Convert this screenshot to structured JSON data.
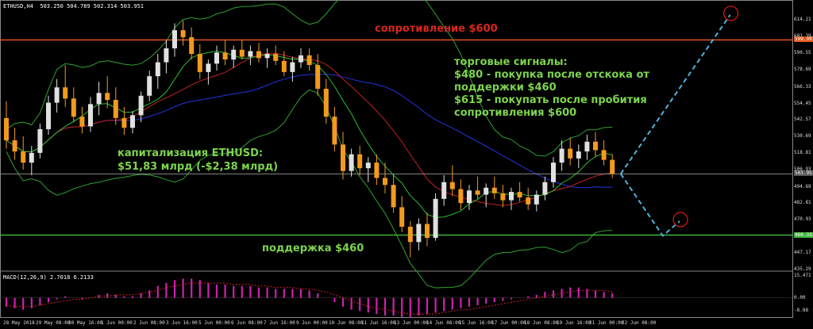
{
  "header": {
    "symbol": "ETHUSD,H4",
    "ohlc": "503.250 504.789 502.314 503.951"
  },
  "macd_header": "MACD(12,26,9) 2.7018 6.2133",
  "annotations": {
    "resistance": "сопротивление $600",
    "support": "поддержка $460",
    "capitalization_title": "капитализация ETHUSD:",
    "capitalization_value": "$51,83 млрд (-$2,38 млрд)",
    "signals_title": "торговые сигналы:",
    "signal_1a": "$480 - покупка после отскока от",
    "signal_1b": "поддержки $460",
    "signal_2a": "$615 - покупать после пробития",
    "signal_2b": "сопротивления $600"
  },
  "colors": {
    "background": "#000000",
    "bull": "#e0e0e0",
    "bear": "#f39a1e",
    "resistance": "#e0561c",
    "support": "#3cb43c",
    "bollinger": "#2fa12f",
    "ma_blue": "#2233dd",
    "ma_red": "#c02020",
    "ma_green": "#2bbd2b",
    "forecast": "#4fb2dd",
    "target_circle": "#e01818",
    "macd_hist": "#d020b0",
    "macd_signal": "#d02020"
  },
  "chart_data": {
    "type": "candlestick",
    "instrument": "ETHUSD",
    "timeframe": "H4",
    "y_axis": {
      "ylim": [
        435.29,
        623
      ],
      "ticks": [
        614.21,
        602.39,
        590.55,
        578.69,
        566.33,
        554.45,
        542.57,
        530.69,
        518.81,
        506.93,
        494.69,
        482.81,
        470.93,
        459.05,
        447.17,
        435.29
      ]
    },
    "levels": {
      "resistance": 600,
      "resistance_label": "599.997",
      "support": 460,
      "support_label": "460.333",
      "current_price": 503.951,
      "current_label": "503.951"
    },
    "x_tick_labels": [
      "28 May 2018",
      "29 May 08:00",
      "30 May 16:00",
      "1 Jun 00:00",
      "2 Jun 08:00",
      "3 Jun 16:00",
      "5 Jun 00:00",
      "6 Jun 08:00",
      "7 Jun 16:00",
      "9 Jun 00:00",
      "10 Jun 08:00",
      "11 Jun 16:00",
      "13 Jun 00:00",
      "14 Jun 08:00",
      "15 Jun 16:00",
      "17 Jun 00:00",
      "18 Jun 08:00",
      "19 Jun 16:00",
      "21 Jun 00:00",
      "22 Jun 08:00"
    ],
    "candles": [
      {
        "o": 544,
        "h": 556,
        "l": 522,
        "c": 528
      },
      {
        "o": 528,
        "h": 537,
        "l": 514,
        "c": 520
      },
      {
        "o": 520,
        "h": 531,
        "l": 507,
        "c": 512
      },
      {
        "o": 512,
        "h": 524,
        "l": 503,
        "c": 519
      },
      {
        "o": 519,
        "h": 540,
        "l": 515,
        "c": 536
      },
      {
        "o": 536,
        "h": 560,
        "l": 532,
        "c": 555
      },
      {
        "o": 555,
        "h": 572,
        "l": 548,
        "c": 566
      },
      {
        "o": 566,
        "h": 582,
        "l": 552,
        "c": 558
      },
      {
        "o": 558,
        "h": 566,
        "l": 541,
        "c": 545
      },
      {
        "o": 545,
        "h": 552,
        "l": 533,
        "c": 538
      },
      {
        "o": 538,
        "h": 559,
        "l": 534,
        "c": 554
      },
      {
        "o": 554,
        "h": 570,
        "l": 546,
        "c": 562
      },
      {
        "o": 562,
        "h": 574,
        "l": 551,
        "c": 557
      },
      {
        "o": 557,
        "h": 566,
        "l": 539,
        "c": 544
      },
      {
        "o": 544,
        "h": 552,
        "l": 532,
        "c": 537
      },
      {
        "o": 537,
        "h": 549,
        "l": 533,
        "c": 546
      },
      {
        "o": 546,
        "h": 563,
        "l": 541,
        "c": 560
      },
      {
        "o": 560,
        "h": 578,
        "l": 556,
        "c": 574
      },
      {
        "o": 574,
        "h": 590,
        "l": 565,
        "c": 584
      },
      {
        "o": 584,
        "h": 600,
        "l": 576,
        "c": 594
      },
      {
        "o": 594,
        "h": 612,
        "l": 588,
        "c": 607
      },
      {
        "o": 607,
        "h": 614,
        "l": 596,
        "c": 602
      },
      {
        "o": 602,
        "h": 609,
        "l": 586,
        "c": 590
      },
      {
        "o": 590,
        "h": 597,
        "l": 572,
        "c": 577
      },
      {
        "o": 577,
        "h": 586,
        "l": 568,
        "c": 583
      },
      {
        "o": 583,
        "h": 596,
        "l": 578,
        "c": 591
      },
      {
        "o": 591,
        "h": 600,
        "l": 582,
        "c": 586
      },
      {
        "o": 586,
        "h": 596,
        "l": 580,
        "c": 593
      },
      {
        "o": 593,
        "h": 600,
        "l": 586,
        "c": 588
      },
      {
        "o": 588,
        "h": 596,
        "l": 582,
        "c": 592
      },
      {
        "o": 592,
        "h": 598,
        "l": 584,
        "c": 587
      },
      {
        "o": 587,
        "h": 594,
        "l": 580,
        "c": 590
      },
      {
        "o": 590,
        "h": 596,
        "l": 582,
        "c": 585
      },
      {
        "o": 585,
        "h": 592,
        "l": 574,
        "c": 577
      },
      {
        "o": 577,
        "h": 588,
        "l": 570,
        "c": 584
      },
      {
        "o": 584,
        "h": 594,
        "l": 580,
        "c": 589
      },
      {
        "o": 589,
        "h": 594,
        "l": 578,
        "c": 582
      },
      {
        "o": 582,
        "h": 590,
        "l": 560,
        "c": 565
      },
      {
        "o": 565,
        "h": 572,
        "l": 540,
        "c": 545
      },
      {
        "o": 545,
        "h": 552,
        "l": 520,
        "c": 525
      },
      {
        "o": 525,
        "h": 534,
        "l": 500,
        "c": 506
      },
      {
        "o": 506,
        "h": 522,
        "l": 502,
        "c": 518
      },
      {
        "o": 518,
        "h": 524,
        "l": 503,
        "c": 508
      },
      {
        "o": 508,
        "h": 516,
        "l": 498,
        "c": 512
      },
      {
        "o": 512,
        "h": 518,
        "l": 496,
        "c": 501
      },
      {
        "o": 501,
        "h": 512,
        "l": 490,
        "c": 496
      },
      {
        "o": 496,
        "h": 504,
        "l": 476,
        "c": 480
      },
      {
        "o": 480,
        "h": 488,
        "l": 462,
        "c": 466
      },
      {
        "o": 466,
        "h": 470,
        "l": 444,
        "c": 455
      },
      {
        "o": 455,
        "h": 472,
        "l": 449,
        "c": 468
      },
      {
        "o": 468,
        "h": 476,
        "l": 452,
        "c": 458
      },
      {
        "o": 458,
        "h": 490,
        "l": 456,
        "c": 486
      },
      {
        "o": 486,
        "h": 503,
        "l": 481,
        "c": 498
      },
      {
        "o": 498,
        "h": 510,
        "l": 488,
        "c": 493
      },
      {
        "o": 493,
        "h": 500,
        "l": 478,
        "c": 483
      },
      {
        "o": 483,
        "h": 496,
        "l": 478,
        "c": 492
      },
      {
        "o": 492,
        "h": 502,
        "l": 486,
        "c": 489
      },
      {
        "o": 489,
        "h": 497,
        "l": 480,
        "c": 494
      },
      {
        "o": 494,
        "h": 502,
        "l": 486,
        "c": 490
      },
      {
        "o": 490,
        "h": 496,
        "l": 480,
        "c": 485
      },
      {
        "o": 485,
        "h": 494,
        "l": 478,
        "c": 491
      },
      {
        "o": 491,
        "h": 498,
        "l": 484,
        "c": 487
      },
      {
        "o": 487,
        "h": 494,
        "l": 478,
        "c": 482
      },
      {
        "o": 482,
        "h": 492,
        "l": 477,
        "c": 489
      },
      {
        "o": 489,
        "h": 502,
        "l": 485,
        "c": 498
      },
      {
        "o": 498,
        "h": 516,
        "l": 494,
        "c": 512
      },
      {
        "o": 512,
        "h": 528,
        "l": 506,
        "c": 522
      },
      {
        "o": 522,
        "h": 530,
        "l": 510,
        "c": 515
      },
      {
        "o": 515,
        "h": 525,
        "l": 508,
        "c": 520
      },
      {
        "o": 520,
        "h": 532,
        "l": 514,
        "c": 527
      },
      {
        "o": 527,
        "h": 534,
        "l": 516,
        "c": 521
      },
      {
        "o": 521,
        "h": 528,
        "l": 510,
        "c": 514
      },
      {
        "o": 514,
        "h": 518,
        "l": 501,
        "c": 504
      }
    ],
    "forecast_path": [
      {
        "i": 73,
        "price": 503.951
      },
      {
        "i": 78,
        "price": 459.5
      },
      {
        "i": 80,
        "price": 470
      }
    ],
    "forecast_path_2": [
      {
        "i": 73,
        "price": 503.951
      },
      {
        "i": 86,
        "price": 618
      }
    ],
    "target_markers": [
      {
        "i": 80,
        "price": 470
      },
      {
        "i": 86,
        "price": 618
      }
    ],
    "macd": {
      "y_ticks": [
        15.471,
        0.0,
        -8.88
      ],
      "ylim": [
        -12,
        17
      ],
      "histogram": [
        -6,
        -7,
        -8,
        -7,
        -5,
        -3,
        -1,
        1,
        0,
        -1,
        0,
        2,
        3,
        2,
        1,
        1,
        3,
        5,
        8,
        10,
        12,
        13,
        13,
        12,
        10,
        9,
        9,
        8,
        8,
        8,
        7,
        7,
        6,
        6,
        6,
        6,
        5,
        3,
        0,
        -3,
        -6,
        -8,
        -9,
        -10,
        -11,
        -12,
        -12,
        -13,
        -13,
        -12,
        -11,
        -10,
        -9,
        -8,
        -7,
        -6,
        -5,
        -4,
        -3,
        -2,
        -1,
        0,
        1,
        2,
        4,
        5,
        6,
        7,
        7,
        6,
        5,
        4,
        3
      ],
      "signal": [
        -5,
        -6,
        -6,
        -6,
        -5,
        -4,
        -3,
        -2,
        -1,
        -1,
        0,
        1,
        1,
        2,
        2,
        2,
        3,
        4,
        5,
        7,
        8,
        9,
        10,
        10,
        10,
        10,
        10,
        9,
        9,
        9,
        8,
        8,
        7,
        7,
        7,
        6,
        6,
        5,
        4,
        2,
        0,
        -2,
        -4,
        -6,
        -7,
        -8,
        -9,
        -10,
        -11,
        -11,
        -11,
        -11,
        -10,
        -9,
        -8,
        -8,
        -7,
        -6,
        -5,
        -4,
        -3,
        -2,
        -1,
        0,
        1,
        2,
        3,
        4,
        5,
        5,
        5,
        5,
        4
      ]
    }
  }
}
